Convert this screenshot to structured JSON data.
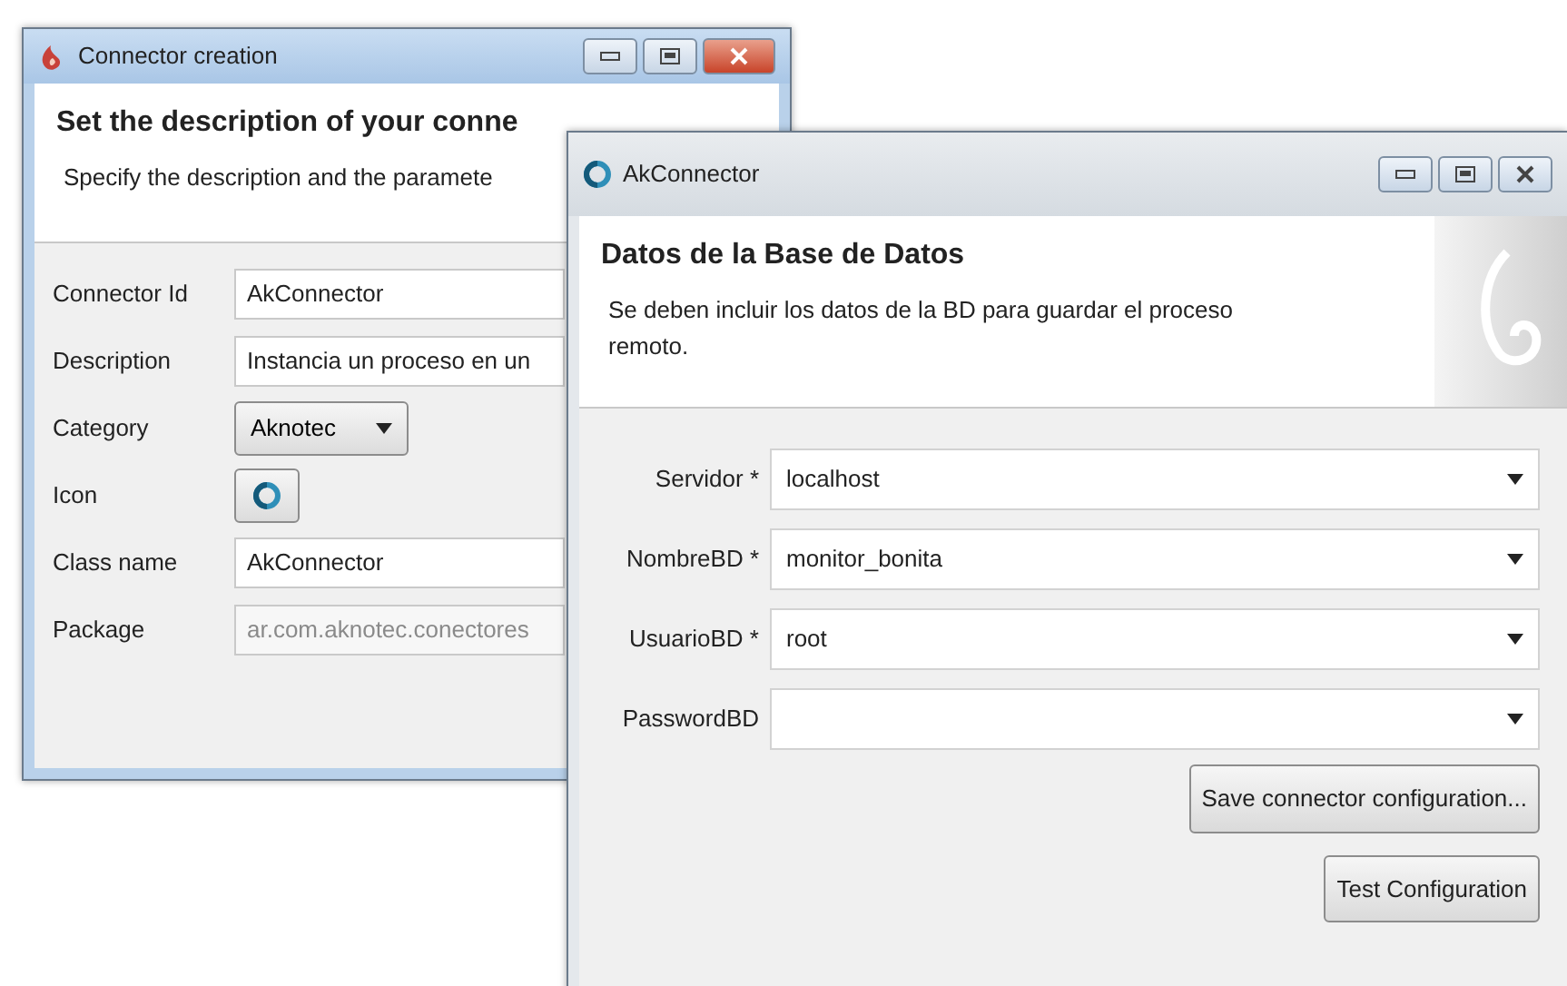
{
  "windows": [
    {
      "title": "Connector creation",
      "heading": "Set the description of your conne",
      "description": "Specify the description and the paramete",
      "fields": [
        {
          "label": "Connector Id",
          "kind": "text",
          "value": "AkConnector"
        },
        {
          "label": "Description",
          "kind": "text",
          "value": "Instancia un proceso en un"
        },
        {
          "label": "Category",
          "kind": "select",
          "value": "Aknotec"
        },
        {
          "label": "Icon",
          "kind": "icon"
        },
        {
          "label": "Class name",
          "kind": "text",
          "value": "AkConnector"
        },
        {
          "label": "Package",
          "kind": "readonly",
          "value": "ar.com.aknotec.conectores"
        }
      ]
    },
    {
      "title": "AkConnector",
      "heading": "Datos de la Base de Datos",
      "description": "Se deben incluir los datos de la BD para guardar el proceso remoto.",
      "fields": [
        {
          "label": "Servidor *",
          "kind": "combo",
          "value": "localhost"
        },
        {
          "label": "NombreBD *",
          "kind": "combo",
          "value": "monitor_bonita"
        },
        {
          "label": "UsuarioBD *",
          "kind": "combo",
          "value": "root"
        },
        {
          "label": "PasswordBD",
          "kind": "combo"
        }
      ],
      "buttons": [
        "Save connector configuration...",
        "Test Configuration"
      ]
    }
  ]
}
